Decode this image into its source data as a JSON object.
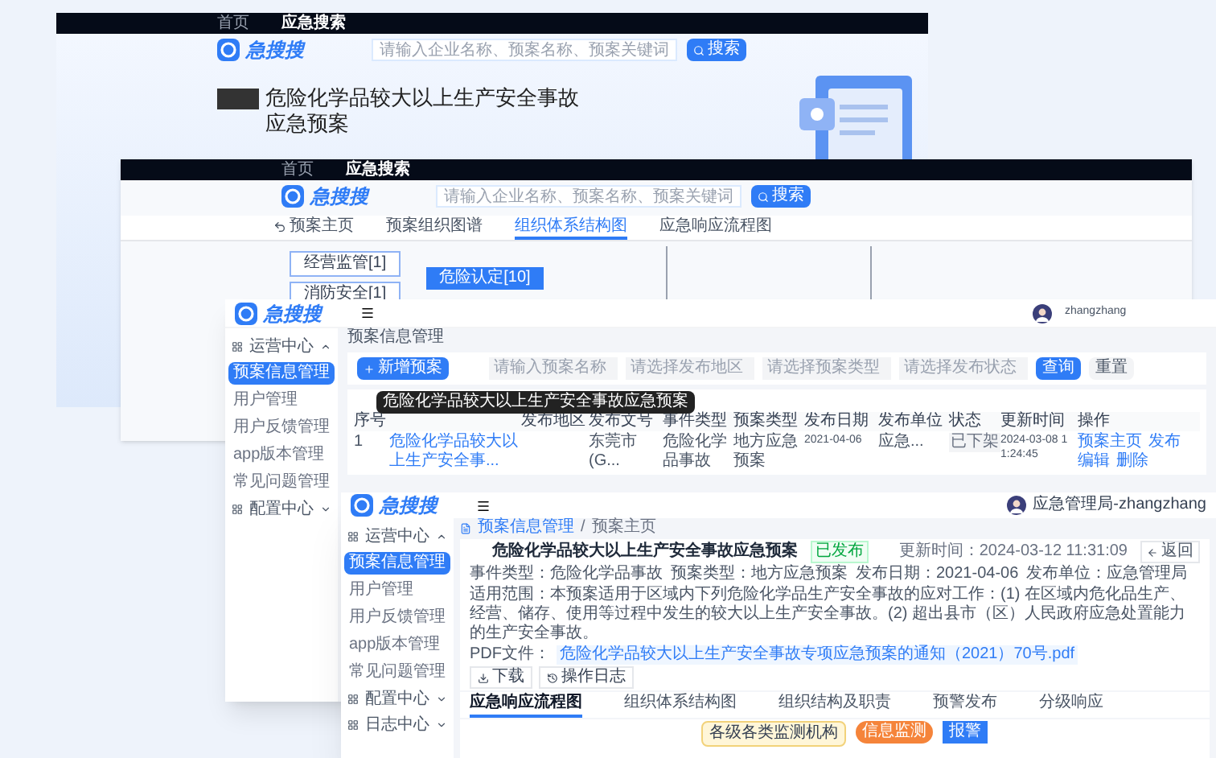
{
  "search_page": {
    "nav": [
      {
        "label": "首页",
        "selected": false
      },
      {
        "label": "应急搜索",
        "selected": true
      }
    ],
    "logo": "急搜搜",
    "search": {
      "placeholder": "请输入企业名称、预案名称、预案关键词"
    },
    "search_button": "搜索",
    "title": "危险化学品较大以上生产安全事故应急预案"
  },
  "graph_page": {
    "nav": [
      {
        "label": "首页",
        "selected": false
      },
      {
        "label": "应急搜索",
        "selected": true
      }
    ],
    "logo": "急搜搜",
    "search": {
      "placeholder": "请输入企业名称、预案名称、预案关键词"
    },
    "search_button": "搜索",
    "tabs": [
      {
        "label": "预案主页",
        "selected": false
      },
      {
        "label": "预案组织图谱",
        "selected": false
      },
      {
        "label": "组织体系结构图",
        "selected": true
      },
      {
        "label": "应急响应流程图",
        "selected": false
      }
    ],
    "nodes": [
      {
        "label": "经营监管[1]",
        "selected": false
      },
      {
        "label": "消防安全[1]",
        "selected": false
      },
      {
        "label": "危险认定[10]",
        "selected": true
      }
    ]
  },
  "list_page": {
    "logo": "急搜搜",
    "user": "zhangzhang",
    "menu": [
      {
        "label": "运营中心",
        "expanded": true,
        "children": [
          {
            "label": "预案信息管理",
            "selected": true
          },
          {
            "label": "用户管理",
            "selected": false
          },
          {
            "label": "用户反馈管理",
            "selected": false
          },
          {
            "label": "app版本管理",
            "selected": false
          },
          {
            "label": "常见问题管理",
            "selected": false
          }
        ]
      },
      {
        "label": "配置中心",
        "expanded": false
      }
    ],
    "breadcrumb": "预案信息管理",
    "add_button": "新增预案",
    "filters": [
      {
        "placeholder": "请输入预案名称"
      },
      {
        "placeholder": "请选择发布地区"
      },
      {
        "placeholder": "请选择预案类型"
      },
      {
        "placeholder": "请选择发布状态"
      }
    ],
    "query_button": "查询",
    "reset_button": "重置",
    "table": {
      "columns": [
        "序号",
        "",
        "发布地区",
        "发布文号",
        "事件类型",
        "预案类型",
        "发布日期",
        "发布单位",
        "状态",
        "更新时间",
        "操作"
      ],
      "rows": [
        {
          "cells": [
            "1",
            "危险化学品较大以上生产安全事...",
            "",
            "东莞市 (G...",
            "危险化学品事故",
            "地方应急预案",
            "2021-04-06",
            "应急...",
            "已下架",
            "2024-03-08 11:24:45"
          ],
          "actions": [
            "预案主页",
            "发布",
            "编辑",
            "删除"
          ]
        }
      ]
    },
    "tooltip": "危险化学品较大以上生产安全事故应急预案"
  },
  "detail_page": {
    "logo": "急搜搜",
    "user": "应急管理局-zhangzhang",
    "menu": [
      {
        "label": "运营中心",
        "expanded": true,
        "children": [
          {
            "label": "预案信息管理",
            "selected": true
          },
          {
            "label": "用户管理",
            "selected": false
          },
          {
            "label": "用户反馈管理",
            "selected": false
          },
          {
            "label": "app版本管理",
            "selected": false
          },
          {
            "label": "常见问题管理",
            "selected": false
          }
        ]
      },
      {
        "label": "配置中心",
        "expanded": false
      },
      {
        "label": "日志中心",
        "expanded": false
      }
    ],
    "breadcrumb": [
      "预案信息管理",
      "/",
      "预案主页"
    ],
    "title": "危险化学品较大以上生产安全事故应急预案",
    "status": "已发布",
    "updated": "更新时间：2024-03-12 11:31:09",
    "back_button": "返回",
    "info": [
      "事件类型：危险化学品事故",
      "预案类型：地方应急预案",
      "发布日期：2021-04-06",
      "发布单位：应急管理局"
    ],
    "scope": "适用范围：本预案适用于区域内下列危险化学品生产安全事故的应对工作：(1) 在区域内危化品生产、经营、储存、使用等过程中发生的较大以上生产安全事故。(2) 超出县市（区）人民政府应急处置能力的生产安全事故。",
    "pdf_label": "PDF文件：",
    "pdf_file": "危险化学品较大以上生产安全事故专项应急预案的通知（2021）70号.pdf",
    "buttons": [
      "下载",
      "操作日志"
    ],
    "tabs": [
      {
        "label": "应急响应流程图",
        "selected": true
      },
      {
        "label": "组织体系结构图",
        "selected": false
      },
      {
        "label": "组织结构及职责",
        "selected": false
      },
      {
        "label": "预警发布",
        "selected": false
      },
      {
        "label": "分级响应",
        "selected": false
      }
    ],
    "flow": [
      {
        "label": "各级各类监测机构",
        "kind": "source"
      },
      {
        "label": "信息监测",
        "kind": "start"
      },
      {
        "label": "报警",
        "kind": "step"
      }
    ]
  }
}
